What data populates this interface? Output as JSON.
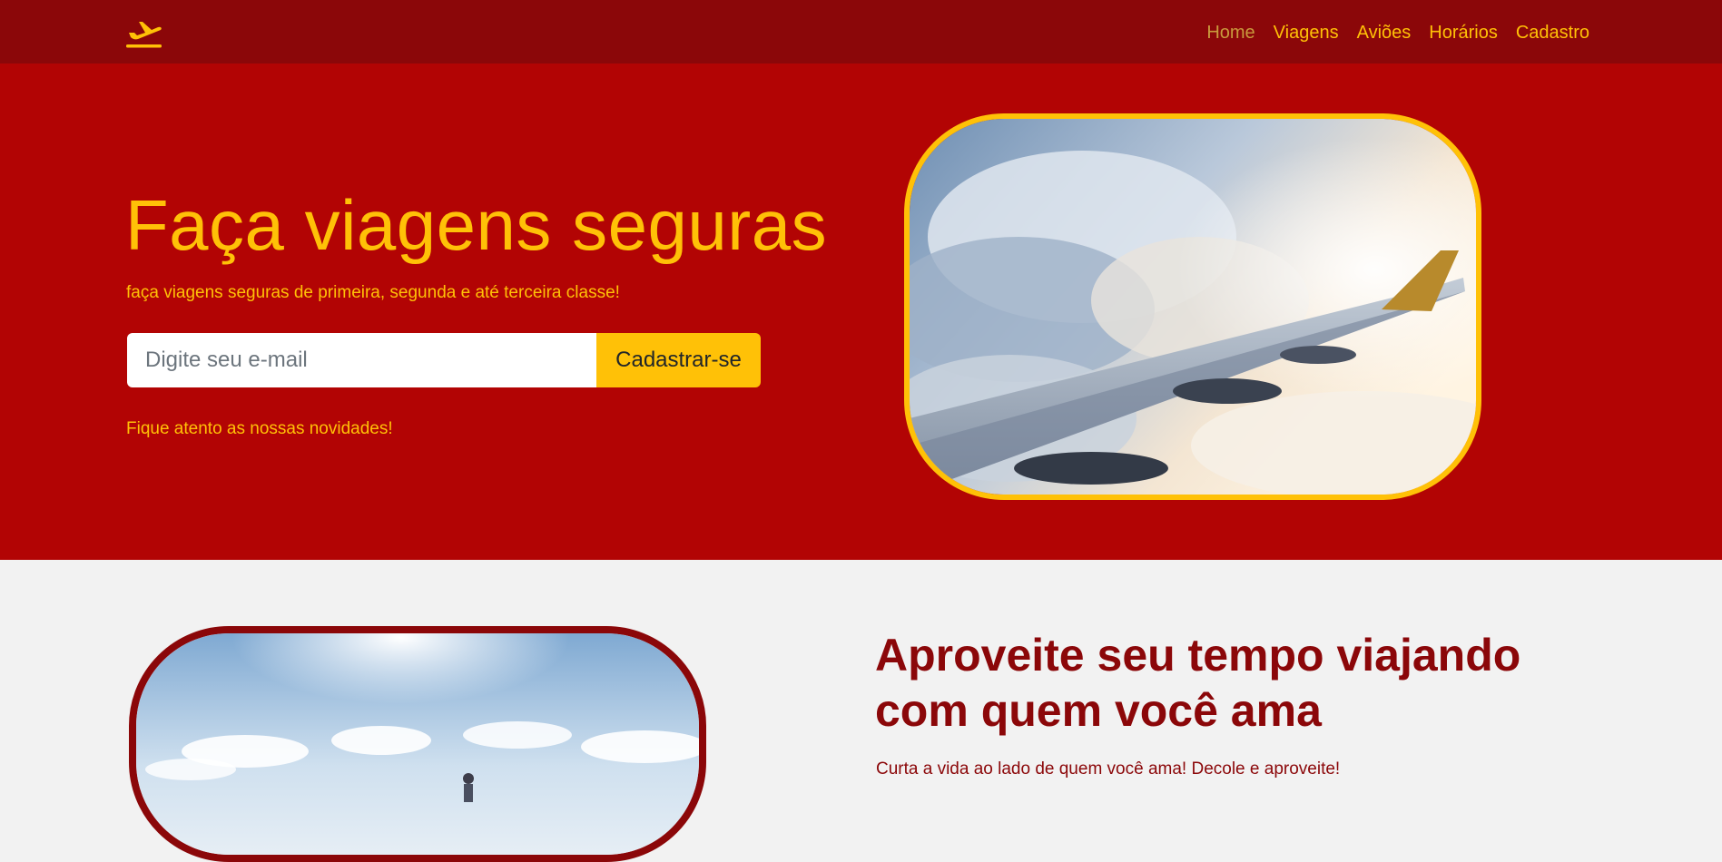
{
  "nav": {
    "logo_icon": "plane-departure-icon",
    "links": [
      {
        "label": "Home",
        "active": true
      },
      {
        "label": "Viagens"
      },
      {
        "label": "Aviões"
      },
      {
        "label": "Horários"
      },
      {
        "label": "Cadastro"
      }
    ]
  },
  "hero": {
    "title": "Faça viagens seguras",
    "subtitle": "faça viagens seguras de primeira, segunda e até terceira classe!",
    "email_placeholder": "Digite seu e-mail",
    "email_value": "",
    "signup_label": "Cadastrar-se",
    "note": "Fique atento as nossas novidades!"
  },
  "second": {
    "title": "Aproveite seu tempo viajando com quem você ama",
    "text": "Curta a vida ao lado de quem você ama! Decole e aproveite!"
  },
  "colors": {
    "nav_bg": "#8b0709",
    "hero_bg": "#b20404",
    "accent": "#ffc107",
    "section_bg": "#f2f2f2",
    "dark_red": "#8b0709"
  }
}
